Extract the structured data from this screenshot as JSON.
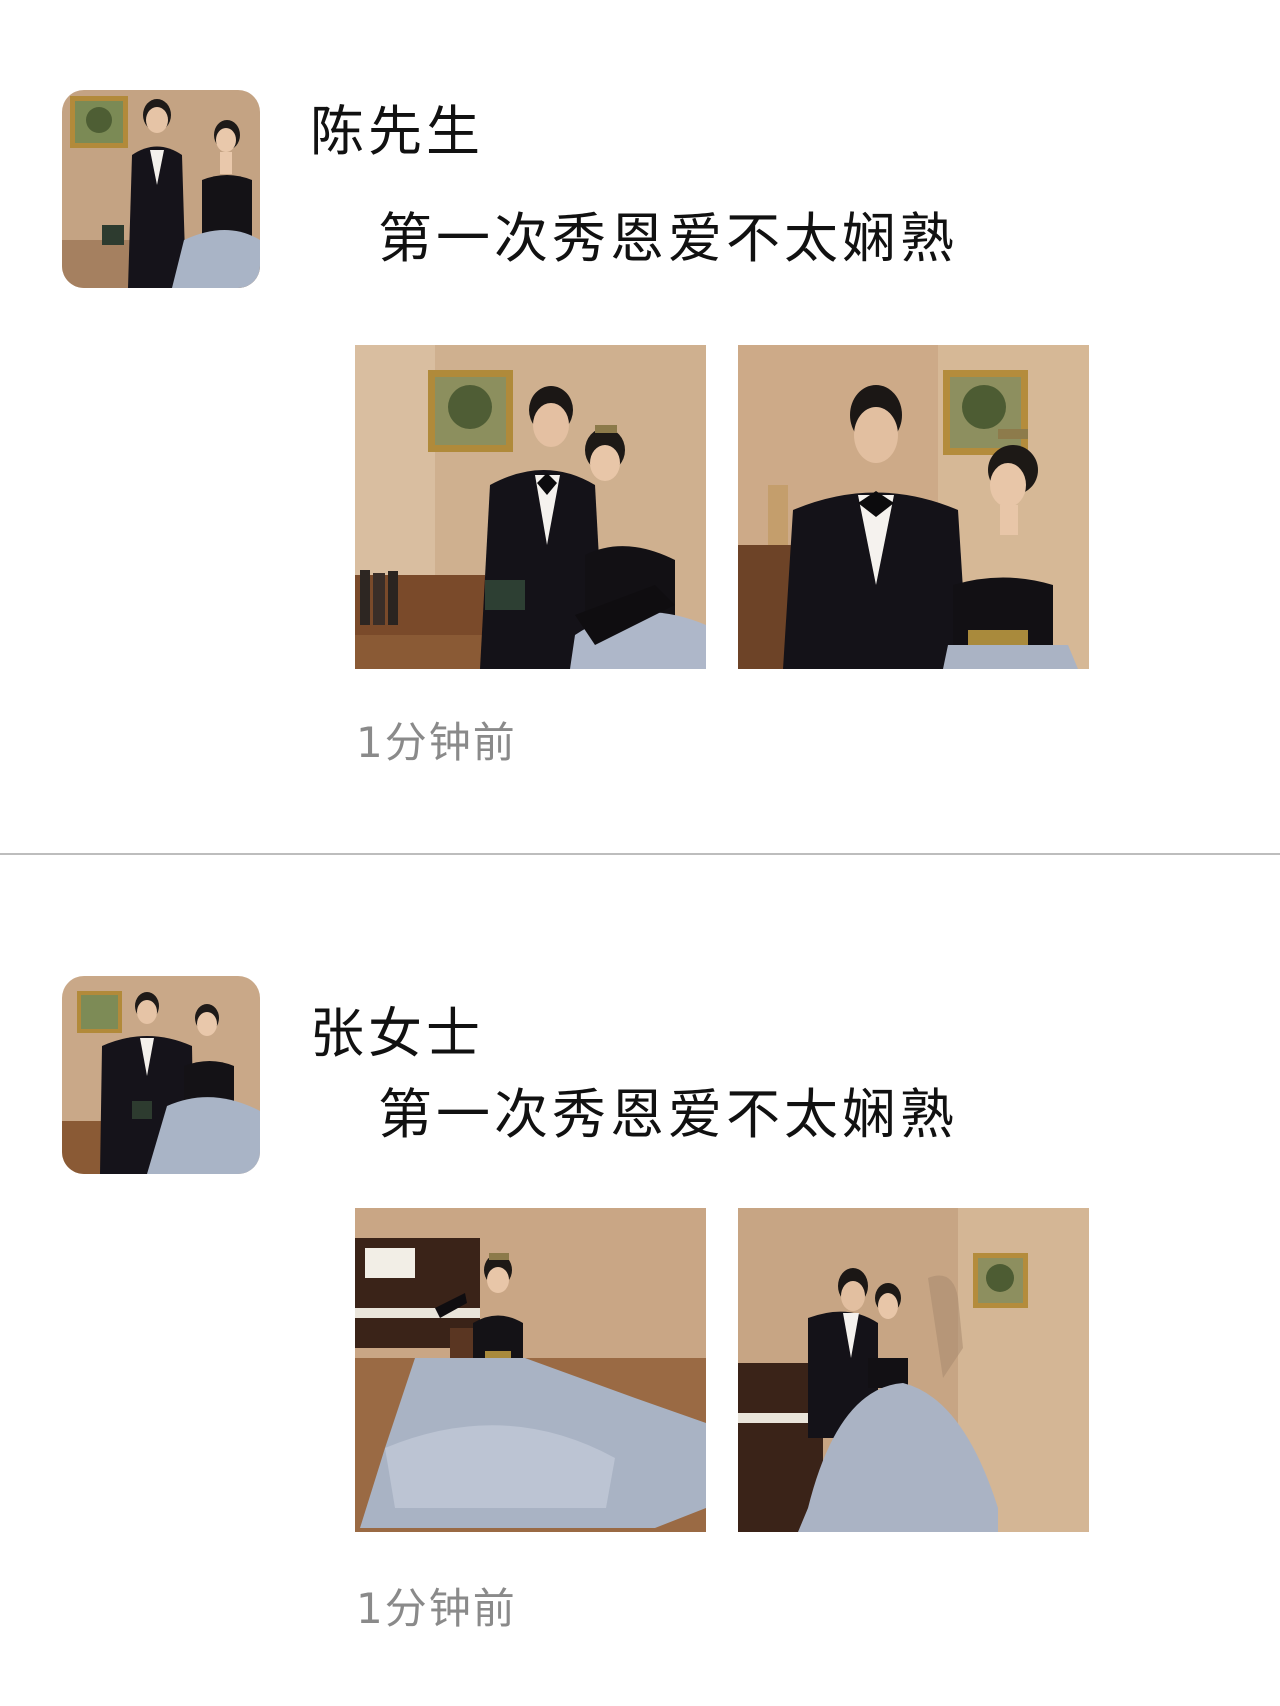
{
  "posts": [
    {
      "username": "陈先生",
      "caption": "第一次秀恩爱不太娴熟",
      "timestamp": "1分钟前"
    },
    {
      "username": "张女士",
      "caption": "第一次秀恩爱不太娴熟",
      "timestamp": "1分钟前"
    }
  ],
  "icons": {
    "avatar": "avatar-photo",
    "photo": "wedding-photo"
  },
  "colors": {
    "background": "#ffffff",
    "text": "#111111",
    "timestamp": "#8a8a8a",
    "divider": "#bdbdbd",
    "wall": "#c9a988"
  }
}
